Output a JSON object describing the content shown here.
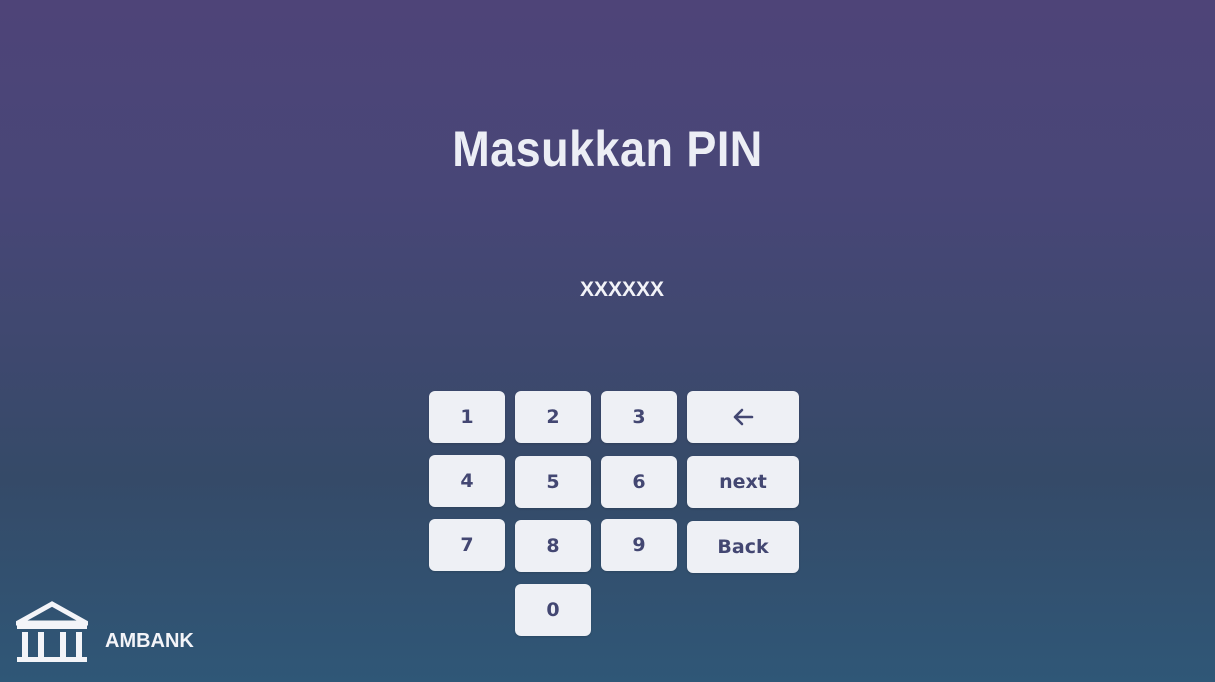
{
  "screen": {
    "title": "Masukkan PIN",
    "pin_display": "XXXXXX"
  },
  "keypad": {
    "k1": "1",
    "k2": "2",
    "k3": "3",
    "k4": "4",
    "k5": "5",
    "k6": "6",
    "k7": "7",
    "k8": "8",
    "k9": "9",
    "k0": "0",
    "backspace_icon": "arrow-left-icon",
    "next_label": "next",
    "back_label": "Back"
  },
  "footer": {
    "logo_icon": "bank-building-icon",
    "brand_name": "AMBANK"
  },
  "colors": {
    "background_top": "#4e4478",
    "background_bottom": "#2f5777",
    "key_background": "#eef0f5",
    "key_text": "#434772",
    "text_light": "#eceef5"
  }
}
